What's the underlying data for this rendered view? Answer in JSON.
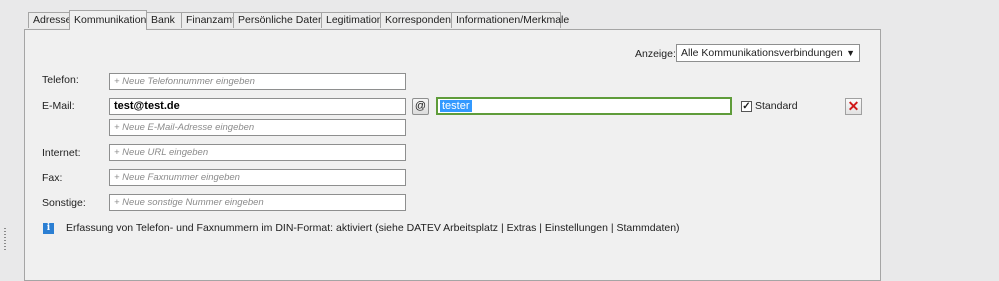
{
  "tabs": [
    "Adresse",
    "Kommunikation",
    "Bank",
    "Finanzamt",
    "Persönliche Daten",
    "Legitimation",
    "Korrespondenz",
    "Informationen/Merkmale"
  ],
  "anzeige": {
    "label": "Anzeige:",
    "value": "Alle Kommunikationsverbindungen"
  },
  "telefon": {
    "label": "Telefon:",
    "placeholder": "+ Neue Telefonnummer eingeben"
  },
  "email": {
    "label": "E-Mail:",
    "value": "test@test.de",
    "at_button": "@",
    "name_value": "tester",
    "standard_label": "Standard",
    "new_placeholder": "+ Neue E-Mail-Adresse eingeben"
  },
  "internet": {
    "label": "Internet:",
    "placeholder": "+ Neue URL eingeben"
  },
  "fax": {
    "label": "Fax:",
    "placeholder": "+ Neue Faxnummer eingeben"
  },
  "sonstige": {
    "label": "Sonstige:",
    "placeholder": "+ Neue sonstige Nummer eingeben"
  },
  "info": {
    "icon": "i",
    "text": "Erfassung von Telefon- und Faxnummern im DIN-Format: aktiviert (siehe DATEV Arbeitsplatz | Extras | Einstellungen | Stammdaten)"
  },
  "icons": {
    "delete": "close-x-icon",
    "dropdown": "chevron-down-icon",
    "info": "info-icon"
  }
}
